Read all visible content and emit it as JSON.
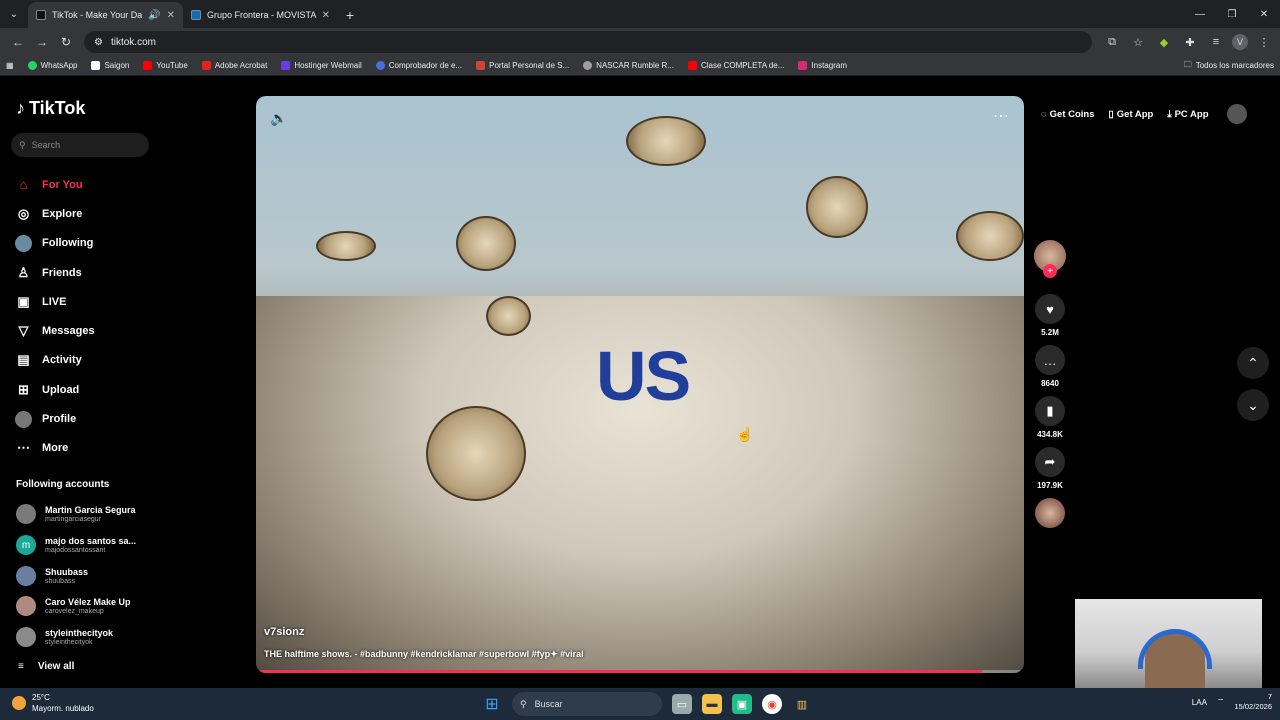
{
  "browser": {
    "tabs": [
      {
        "title": "TikTok - Make Your Day",
        "active": true
      },
      {
        "title": "Grupo Frontera - MOVISTAR AR",
        "active": false
      }
    ],
    "url": "tiktok.com",
    "bookmarks": [
      {
        "label": "WhatsApp",
        "color": "#25d366"
      },
      {
        "label": "Saigon",
        "color": "#ffffff"
      },
      {
        "label": "YouTube",
        "color": "#ff0000"
      },
      {
        "label": "Adobe Acrobat",
        "color": "#e2231a"
      },
      {
        "label": "Hostinger Webmail",
        "color": "#673de6"
      },
      {
        "label": "Comprobador de e...",
        "color": "#4a6ee0"
      },
      {
        "label": "Portal Personal de S...",
        "color": "#d0433a"
      },
      {
        "label": "NASCAR Rumble R...",
        "color": "#9aa0a6"
      },
      {
        "label": "Clase COMPLETA de...",
        "color": "#ff0000"
      },
      {
        "label": "Instagram",
        "color": "#d62976"
      }
    ],
    "all_bookmarks": "Todos los marcadores"
  },
  "tiktok": {
    "logo": "TikTok",
    "search_placeholder": "Search",
    "nav": [
      {
        "label": "For You",
        "icon": "home-icon",
        "glyph": "⌂",
        "active": true
      },
      {
        "label": "Explore",
        "icon": "compass-icon",
        "glyph": "◎",
        "active": false
      },
      {
        "label": "Following",
        "icon": "following-avatar-icon",
        "glyph": "●",
        "active": false
      },
      {
        "label": "Friends",
        "icon": "friends-icon",
        "glyph": "♙",
        "active": false
      },
      {
        "label": "LIVE",
        "icon": "live-icon",
        "glyph": "▣",
        "active": false
      },
      {
        "label": "Messages",
        "icon": "messages-icon",
        "glyph": "▽",
        "active": false
      },
      {
        "label": "Activity",
        "icon": "activity-icon",
        "glyph": "▤",
        "active": false
      },
      {
        "label": "Upload",
        "icon": "upload-icon",
        "glyph": "⊞",
        "active": false
      },
      {
        "label": "Profile",
        "icon": "profile-icon",
        "glyph": "●",
        "active": false
      },
      {
        "label": "More",
        "icon": "more-icon",
        "glyph": "⋯",
        "active": false
      }
    ],
    "following_title": "Following accounts",
    "following_accounts": [
      {
        "name": "Martin Garcia Segura",
        "handle": "martingarciasegur",
        "color": "#7a7a7a",
        "initial": ""
      },
      {
        "name": "majo dos santos sa...",
        "handle": "majodossantossant",
        "color": "#1aa89a",
        "initial": "m"
      },
      {
        "name": "Shuubass",
        "handle": "shuubass",
        "color": "#6a7fa0",
        "initial": ""
      },
      {
        "name": "Caro Vélez Make Up",
        "handle": "carovelez_makeup",
        "color": "#b08a80",
        "initial": ""
      },
      {
        "name": "styleinthecityok",
        "handle": "styleinthecityok",
        "color": "#8a8a8a",
        "initial": ""
      }
    ],
    "view_all": "View all",
    "top_right": {
      "get_coins": "Get Coins",
      "get_app": "Get App",
      "pc_app": "PC App"
    },
    "video": {
      "overlay_text": "US",
      "author": "v7sionz",
      "caption": "THE halftime shows. - #badbunny #kendricklamar #superbowl #fyp✦ #viral",
      "progress": 0.95
    },
    "actions": {
      "likes": "5.2M",
      "comments": "8640",
      "saves": "434.8K",
      "shares": "197.9K"
    }
  },
  "taskbar": {
    "temp": "25°C",
    "weather": "Mayorm. nublado",
    "search": "Buscar",
    "lang": "LAA",
    "time": "7",
    "date": "15/02/2026"
  }
}
